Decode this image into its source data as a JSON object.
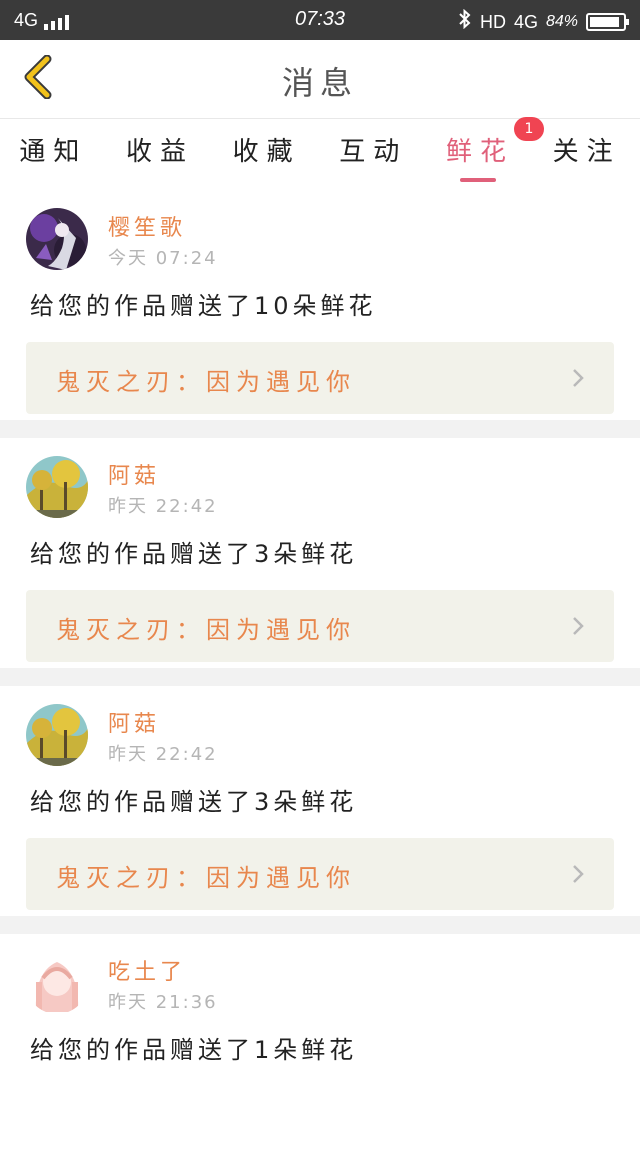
{
  "status_bar": {
    "network": "4G",
    "time": "07:33",
    "hd": "HD",
    "network_right": "4G",
    "battery": "84%"
  },
  "header": {
    "title": "消息"
  },
  "tabs": [
    {
      "label": "通知"
    },
    {
      "label": "收益"
    },
    {
      "label": "收藏"
    },
    {
      "label": "互动"
    },
    {
      "label": "鲜花",
      "active": true,
      "badge": "1"
    },
    {
      "label": "关注"
    }
  ],
  "feed": [
    {
      "username": "樱笙歌",
      "time": "今天  07:24",
      "message": "给您的作品赠送了10朵鲜花",
      "work": "鬼灭之刃：因为遇见你"
    },
    {
      "username": "阿菇",
      "time": "昨天  22:42",
      "message": "给您的作品赠送了3朵鲜花",
      "work": "鬼灭之刃：因为遇见你"
    },
    {
      "username": "阿菇",
      "time": "昨天  22:42",
      "message": "给您的作品赠送了3朵鲜花",
      "work": "鬼灭之刃：因为遇见你"
    },
    {
      "username": "吃土了",
      "time": "昨天  21:36",
      "message": "给您的作品赠送了1朵鲜花",
      "work": ""
    }
  ],
  "colors": {
    "accent": "#e0607a",
    "username": "#e8874d",
    "badge": "#f04452",
    "back_icon": "#f2c21b"
  },
  "icons": {
    "back": "chevron-left-icon",
    "bluetooth": "bluetooth-icon",
    "card_arrow": "chevron-right-icon"
  }
}
